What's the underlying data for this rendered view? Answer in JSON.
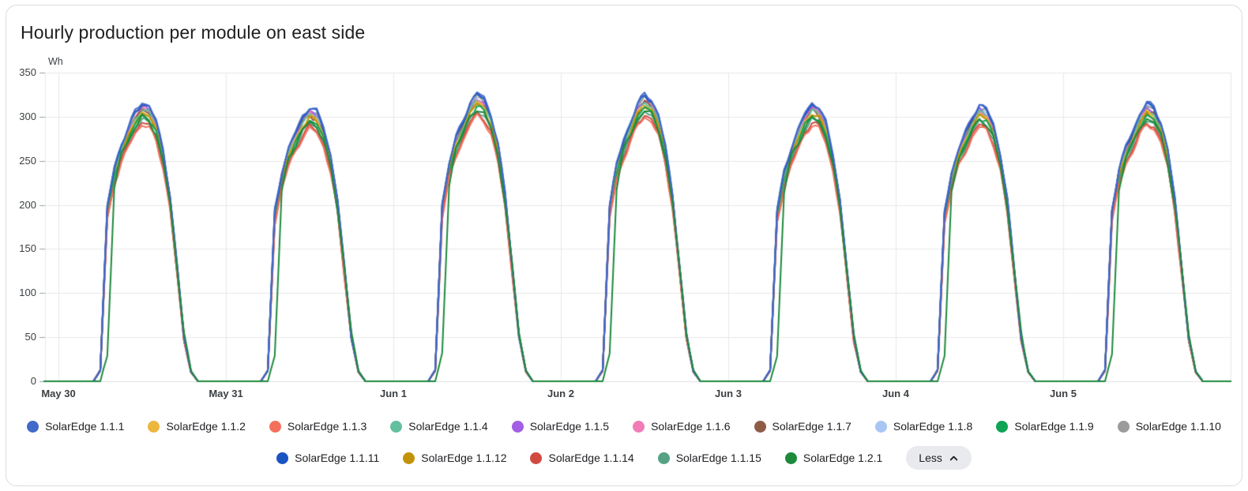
{
  "card": {
    "title": "Hourly production per module on east side"
  },
  "chart_data": {
    "type": "line",
    "title": "Hourly production per module on east side",
    "xlabel": "",
    "ylabel": "Wh",
    "ylim": [
      0,
      350
    ],
    "yticks": [
      350,
      300,
      250,
      200,
      150,
      100,
      50,
      0
    ],
    "x_categories": [
      "May 30",
      "May 31",
      "Jun 1",
      "Jun 2",
      "Jun 3",
      "Jun 4",
      "Jun 5"
    ],
    "grid": true,
    "legend_position": "bottom",
    "time_resolution": "hourly, 7 days (x in hours 0-168)",
    "day_peaks_wh": [
      318,
      312,
      327,
      325,
      315,
      313,
      316
    ],
    "day_shape_fraction_by_hour": [
      0,
      0,
      0,
      0,
      0,
      0,
      0.04,
      0.62,
      0.76,
      0.845,
      0.905,
      0.965,
      1.0,
      0.985,
      0.93,
      0.825,
      0.66,
      0.41,
      0.16,
      0.035,
      0,
      0,
      0,
      0
    ],
    "day_shape_fraction_by_hour_lagged": [
      0,
      0,
      0,
      0,
      0,
      0,
      0,
      0.1,
      0.72,
      0.86,
      0.905,
      0.965,
      1.0,
      0.985,
      0.93,
      0.825,
      0.66,
      0.43,
      0.18,
      0.04,
      0,
      0,
      0,
      0
    ],
    "series_note": "each series value = day_peak * scale * shape(hour); lagged shape for SolarEdge 1.2.1",
    "series": [
      {
        "name": "SolarEdge 1.1.1",
        "color": "#4069C9",
        "scale": 1.0,
        "lagged": false
      },
      {
        "name": "SolarEdge 1.1.2",
        "color": "#EDB63E",
        "scale": 0.965,
        "lagged": false
      },
      {
        "name": "SolarEdge 1.1.3",
        "color": "#F4705C",
        "scale": 0.92,
        "lagged": false
      },
      {
        "name": "SolarEdge 1.1.4",
        "color": "#63BF9E",
        "scale": 0.972,
        "lagged": false
      },
      {
        "name": "SolarEdge 1.1.5",
        "color": "#A35EE3",
        "scale": 0.982,
        "lagged": false
      },
      {
        "name": "SolarEdge 1.1.6",
        "color": "#F17CB8",
        "scale": 0.978,
        "lagged": false
      },
      {
        "name": "SolarEdge 1.1.7",
        "color": "#8E5C46",
        "scale": 0.97,
        "lagged": false
      },
      {
        "name": "SolarEdge 1.1.8",
        "color": "#A8C6F5",
        "scale": 0.99,
        "lagged": false
      },
      {
        "name": "SolarEdge 1.1.9",
        "color": "#0FA355",
        "scale": 0.952,
        "lagged": false
      },
      {
        "name": "SolarEdge 1.1.10",
        "color": "#9B9B9B",
        "scale": 0.986,
        "lagged": false
      },
      {
        "name": "SolarEdge 1.1.11",
        "color": "#1A53C2",
        "scale": 0.995,
        "lagged": false
      },
      {
        "name": "SolarEdge 1.1.12",
        "color": "#C29307",
        "scale": 0.96,
        "lagged": false
      },
      {
        "name": "SolarEdge 1.1.14",
        "color": "#D04A40",
        "scale": 0.928,
        "lagged": false
      },
      {
        "name": "SolarEdge 1.1.15",
        "color": "#55A284",
        "scale": 0.94,
        "lagged": false
      },
      {
        "name": "SolarEdge 1.2.1",
        "color": "#1D8A3C",
        "scale": 0.945,
        "lagged": true
      }
    ]
  },
  "legend": {
    "less_button": {
      "label": "Less",
      "icon": "chevron-up-icon"
    }
  },
  "colors": {
    "grid": "#e8e8e8",
    "baseline": "#e0e0e0",
    "tick_mark": "#9aa0a6",
    "axis_text": "#3c4043",
    "title_text": "#1f1f1f",
    "card_border": "#dadce0",
    "pill_bg": "#e8eaed"
  }
}
